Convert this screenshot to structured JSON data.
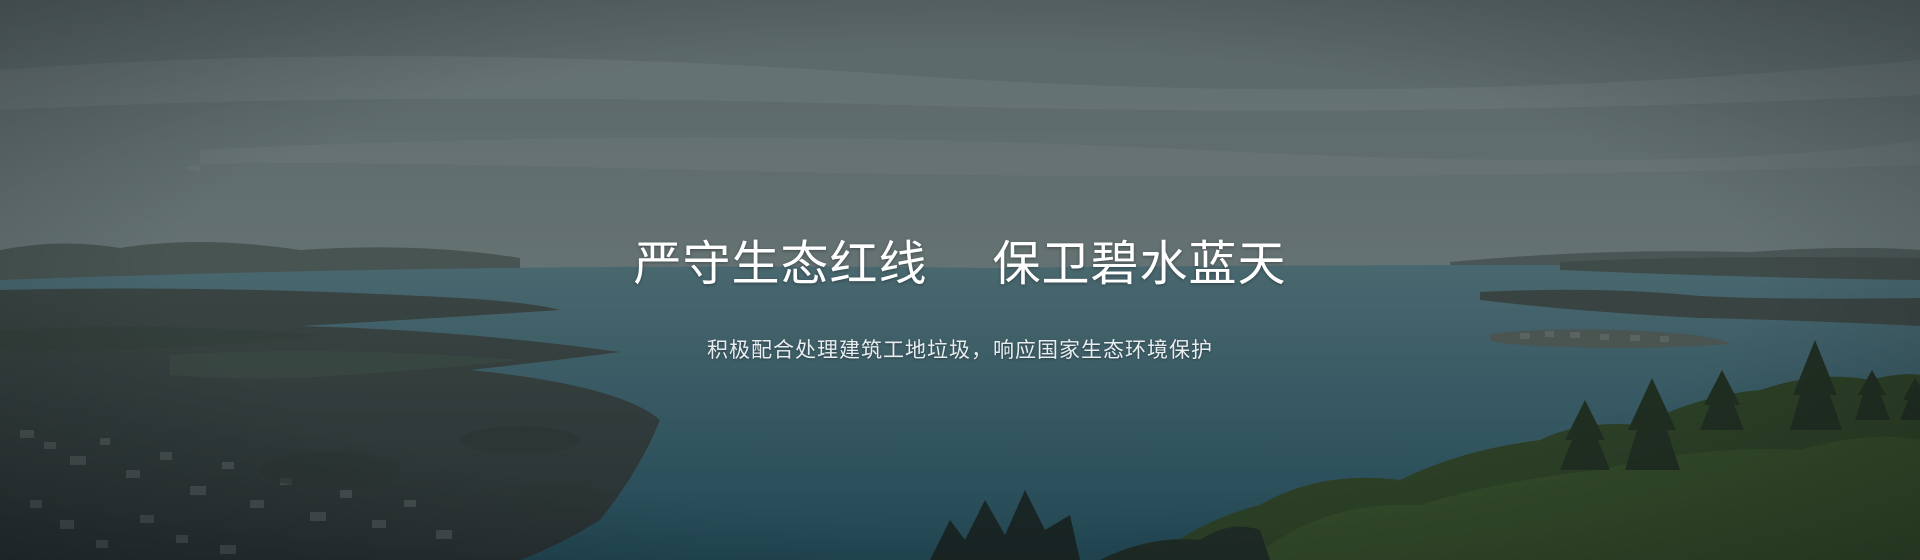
{
  "banner": {
    "title": "严守生态红线    保卫碧水蓝天",
    "subtitle": "积极配合处理建筑工地垃圾，响应国家生态环境保护"
  }
}
